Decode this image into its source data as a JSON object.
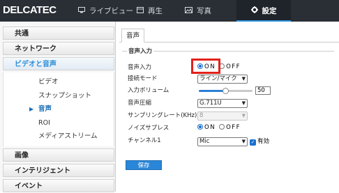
{
  "brand": "DELCATEC",
  "nav": {
    "live": "ライブビュー",
    "playback": "再生",
    "photo": "写真",
    "settings": "設定"
  },
  "sidebar": {
    "sections": [
      "共通",
      "ネットワーク",
      "ビデオと音声",
      "画像",
      "インテリジェント",
      "イベント"
    ],
    "video_audio_items": [
      "ビデオ",
      "スナップショット",
      "音声",
      "ROI",
      "メディアストリーム"
    ],
    "active_item": "音声"
  },
  "tab": "音声",
  "panel": {
    "legend": "音声入力",
    "fields": {
      "audio_input": {
        "label": "音声入力",
        "on": "ON",
        "off": "OFF",
        "selected": "ON"
      },
      "connection_mode": {
        "label": "接続モード",
        "value": "ライン/マイク"
      },
      "input_volume": {
        "label": "入力ボリューム",
        "value": "50",
        "level": 0.5
      },
      "audio_compression": {
        "label": "音声圧縮",
        "value": "G.711U"
      },
      "sampling_rate": {
        "label": "サンプリングレート(KHz)",
        "value": "8"
      },
      "noise_suppress": {
        "label": "ノイズサプレス",
        "on": "ON",
        "off": "OFF",
        "selected": "ON"
      },
      "channel": {
        "label": "チャンネル1",
        "value": "Mic",
        "enabled_label": "有効",
        "enabled": true
      }
    }
  },
  "save_label": "保存",
  "colors": {
    "accent": "#2a86d8",
    "highlight": "#e3201b",
    "topbar": "#2a2f36"
  }
}
